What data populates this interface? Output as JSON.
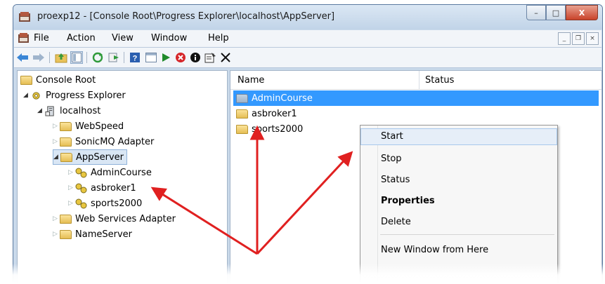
{
  "window": {
    "title": "proexp12 - [Console Root\\Progress Explorer\\localhost\\AppServer]",
    "caption_buttons": [
      "–",
      "□",
      "X"
    ],
    "mdi_buttons": [
      "_",
      "❐",
      "×"
    ]
  },
  "menu": {
    "items": [
      "File",
      "Action",
      "View",
      "Window",
      "Help"
    ]
  },
  "toolbar": {
    "icons": [
      "back-icon",
      "forward-icon",
      "up-folder-icon",
      "show-tree-icon",
      "refresh-icon",
      "export-icon",
      "help-icon",
      "console-icon",
      "start-icon",
      "stop-icon",
      "info-icon",
      "properties-icon",
      "delete-icon"
    ]
  },
  "tree": {
    "nodes": [
      {
        "label": "Console Root"
      },
      {
        "label": "Progress Explorer"
      },
      {
        "label": "localhost"
      },
      {
        "label": "WebSpeed"
      },
      {
        "label": "SonicMQ Adapter"
      },
      {
        "label": "AppServer"
      },
      {
        "label": "AdminCourse"
      },
      {
        "label": "asbroker1"
      },
      {
        "label": "sports2000"
      },
      {
        "label": "Web Services Adapter"
      },
      {
        "label": "NameServer"
      }
    ]
  },
  "list": {
    "columns": [
      "Name",
      "Status"
    ],
    "rows": [
      {
        "name": "AdminCourse",
        "selected": true
      },
      {
        "name": "asbroker1"
      },
      {
        "name": "sports2000"
      }
    ]
  },
  "context_menu": {
    "items": [
      "Start",
      "Stop",
      "Status",
      "Properties",
      "Delete",
      "New Window from Here"
    ],
    "highlighted": "Start",
    "bold": "Properties"
  },
  "colors": {
    "selection": "#3399ff",
    "annotation_arrow": "#e02020",
    "title_bar": "#c9d9ea"
  }
}
